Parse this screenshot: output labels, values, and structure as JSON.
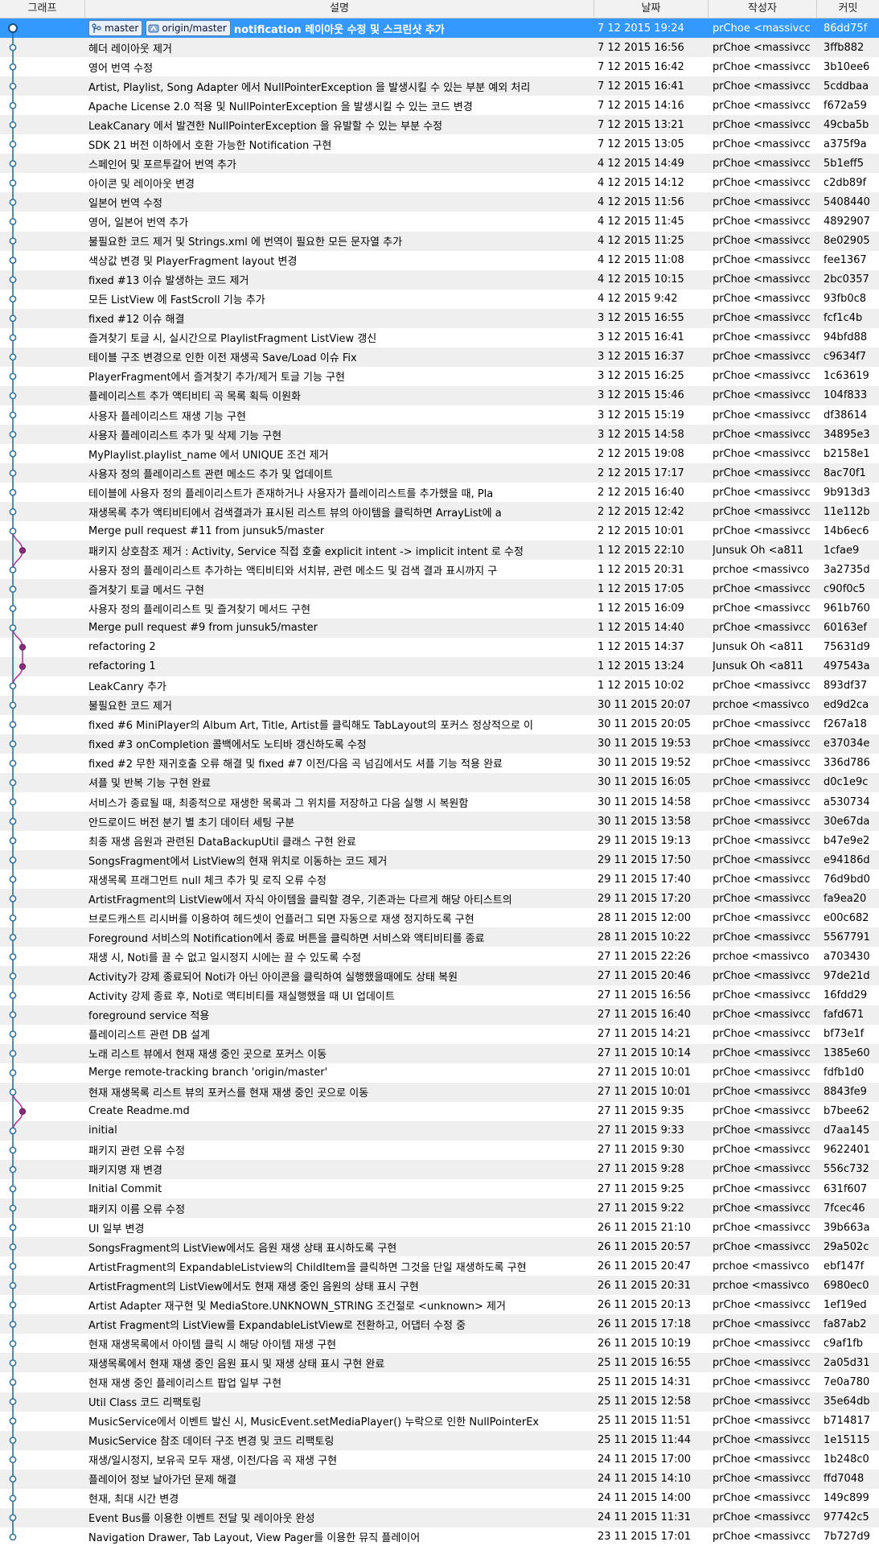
{
  "header": {
    "graph": "그래프",
    "desc": "설명",
    "date": "날짜",
    "author": "작성자",
    "commit": "커밋"
  },
  "tags": [
    {
      "label": "master",
      "icon": "branch-icon"
    },
    {
      "label": "origin/master",
      "icon": "remote-branch-icon"
    }
  ],
  "colors": {
    "selected_row": "#3399ff",
    "main_line": "#2a6f9e",
    "side_line": "#b03aa0",
    "alt_row": "#efefef"
  },
  "commits": [
    {
      "desc": "notification 레이아웃 수정 및 스크린샷 추가",
      "date": "7 12 2015 19:24",
      "author": "prChoe <massivcc",
      "hash": "86dd75f",
      "lane": 0,
      "selected": true,
      "tags": true
    },
    {
      "desc": "헤더 레이아웃 제거",
      "date": "7 12 2015 16:56",
      "author": "prChoe <massivcc",
      "hash": "3ffb882",
      "lane": 0
    },
    {
      "desc": "영어 번역 수정",
      "date": "7 12 2015 16:42",
      "author": "prChoe <massivcc",
      "hash": "3b10ee6",
      "lane": 0
    },
    {
      "desc": "Artist, Playlist, Song Adapter 에서 NullPointerException 을 발생시킬 수 있는 부분 예외 처리",
      "date": "7 12 2015 16:41",
      "author": "prChoe <massivcc",
      "hash": "5cddbaa",
      "lane": 0
    },
    {
      "desc": "Apache License 2.0 적용 및 NullPointerException 을 발생시킬 수 있는 코드 변경",
      "date": "7 12 2015 14:16",
      "author": "prChoe <massivcc",
      "hash": "f672a59",
      "lane": 0
    },
    {
      "desc": "LeakCanary 에서 발견한 NullPointerException 을 유발할 수 있는 부분 수정",
      "date": "7 12 2015 13:21",
      "author": "prChoe <massivcc",
      "hash": "49cba5b",
      "lane": 0
    },
    {
      "desc": "SDK 21 버전 이하에서 호환 가능한 Notification 구현",
      "date": "7 12 2015 13:05",
      "author": "prChoe <massivcc",
      "hash": "a375f9a",
      "lane": 0
    },
    {
      "desc": "스페인어 및 포르투갈어 번역 추가",
      "date": "4 12 2015 14:49",
      "author": "prChoe <massivcc",
      "hash": "5b1eff5",
      "lane": 0
    },
    {
      "desc": "아이콘 및 레이아웃 변경",
      "date": "4 12 2015 14:12",
      "author": "prChoe <massivcc",
      "hash": "c2db89f",
      "lane": 0
    },
    {
      "desc": "일본어 번역 수정",
      "date": "4 12 2015 11:56",
      "author": "prChoe <massivcc",
      "hash": "5408440",
      "lane": 0
    },
    {
      "desc": "영어, 일본어 번역 추가",
      "date": "4 12 2015 11:45",
      "author": "prChoe <massivcc",
      "hash": "4892907",
      "lane": 0
    },
    {
      "desc": "불필요한 코드 제거 및 Strings.xml 에 번역이 필요한 모든 문자열 추가",
      "date": "4 12 2015 11:25",
      "author": "prChoe <massivcc",
      "hash": "8e02905",
      "lane": 0
    },
    {
      "desc": "색상값 변경 및 PlayerFragment layout 변경",
      "date": "4 12 2015 11:08",
      "author": "prChoe <massivcc",
      "hash": "fee1367",
      "lane": 0
    },
    {
      "desc": "fixed #13 이슈 발생하는 코드 제거",
      "date": "4 12 2015 10:15",
      "author": "prChoe <massivcc",
      "hash": "2bc0357",
      "lane": 0
    },
    {
      "desc": "모든 ListView 에 FastScroll 기능 추가",
      "date": "4 12 2015 9:42",
      "author": "prChoe <massivcc",
      "hash": "93fb0c8",
      "lane": 0
    },
    {
      "desc": "fixed #12 이슈 해결",
      "date": "3 12 2015 16:55",
      "author": "prChoe <massivcc",
      "hash": "fcf1c4b",
      "lane": 0
    },
    {
      "desc": "즐겨찾기 토글 시, 실시간으로 PlaylistFragment ListView 갱신",
      "date": "3 12 2015 16:41",
      "author": "prChoe <massivcc",
      "hash": "94bfd88",
      "lane": 0
    },
    {
      "desc": "테이블 구조 변경으로 인한 이전 재생곡 Save/Load 이슈 Fix",
      "date": "3 12 2015 16:37",
      "author": "prChoe <massivcc",
      "hash": "c9634f7",
      "lane": 0
    },
    {
      "desc": "PlayerFragment에서 즐겨찾기 추가/제거 토글 기능 구현",
      "date": "3 12 2015 16:25",
      "author": "prChoe <massivcc",
      "hash": "1c63619",
      "lane": 0
    },
    {
      "desc": "플레이리스트 추가 액티비티 곡 목록 획득 이원화",
      "date": "3 12 2015 15:46",
      "author": "prChoe <massivcc",
      "hash": "104f833",
      "lane": 0
    },
    {
      "desc": "사용자 플레이리스트 재생 기능 구현",
      "date": "3 12 2015 15:19",
      "author": "prChoe <massivcc",
      "hash": "df38614",
      "lane": 0
    },
    {
      "desc": "사용자 플레이리스트 추가 및 삭제 기능 구현",
      "date": "3 12 2015 14:58",
      "author": "prChoe <massivcc",
      "hash": "34895e3",
      "lane": 0
    },
    {
      "desc": "MyPlaylist.playlist_name 에서 UNIQUE 조건 제거",
      "date": "2 12 2015 19:08",
      "author": "prChoe <massivcc",
      "hash": "b2158e1",
      "lane": 0
    },
    {
      "desc": "사용자 정의 플레이리스트 관련 메소드 추가 및 업데이트",
      "date": "2 12 2015 17:17",
      "author": "prChoe <massivcc",
      "hash": "8ac70f1",
      "lane": 0
    },
    {
      "desc": "테이블에 사용자 정의 플레이리스트가 존재하거나 사용자가 플레이리스트를 추가했을 때, Pla",
      "date": "2 12 2015 16:40",
      "author": "prChoe <massivcc",
      "hash": "9b913d3",
      "lane": 0
    },
    {
      "desc": "재생목록 추가 액티비티에서 검색결과가 표시된 리스트 뷰의 아이템을 클릭하면 ArrayList에 a",
      "date": "2 12 2015 12:42",
      "author": "prChoe <massivcc",
      "hash": "11e112b",
      "lane": 0
    },
    {
      "desc": "Merge pull request #11 from junsuk5/master",
      "date": "2 12 2015 10:01",
      "author": "prChoe <massivcc",
      "hash": "14b6ec6",
      "lane": 0
    },
    {
      "desc": "패키지 상호참조 제거 : Activity, Service 직접 호출 explicit intent -> implicit intent 로 수정",
      "date": "1 12 2015 22:10",
      "author": "Junsuk Oh <a811",
      "hash": "1cfae9",
      "lane": 1
    },
    {
      "desc": "사용자 정의 플레이리스트 추가하는 액티비티와 서치뷰, 관련 메소드 및 검색 결과 표시까지 구",
      "date": "1 12 2015 20:31",
      "author": "prchoe <massivco",
      "hash": "3a2735d",
      "lane": 0
    },
    {
      "desc": "즐겨찾기 토글 메서드 구현",
      "date": "1 12 2015 17:05",
      "author": "prChoe <massivcc",
      "hash": "c90f0c5",
      "lane": 0
    },
    {
      "desc": "사용자 정의 플레이리스트 및 즐겨찾기 메서드 구현",
      "date": "1 12 2015 16:09",
      "author": "prChoe <massivcc",
      "hash": "961b760",
      "lane": 0
    },
    {
      "desc": "Merge pull request #9 from junsuk5/master",
      "date": "1 12 2015 14:40",
      "author": "prChoe <massivcc",
      "hash": "60163ef",
      "lane": 0
    },
    {
      "desc": "refactoring 2",
      "date": "1 12 2015 14:37",
      "author": "Junsuk Oh <a811",
      "hash": "75631d9",
      "lane": 1
    },
    {
      "desc": "refactoring 1",
      "date": "1 12 2015 13:24",
      "author": "Junsuk Oh <a811",
      "hash": "497543a",
      "lane": 1
    },
    {
      "desc": "LeakCanry 추가",
      "date": "1 12 2015 10:02",
      "author": "prChoe <massivcc",
      "hash": "893df37",
      "lane": 0
    },
    {
      "desc": "불필요한 코드 제거",
      "date": "30 11 2015 20:07",
      "author": "prchoe <massivco",
      "hash": "ed9d2ca",
      "lane": 0
    },
    {
      "desc": "fixed #6 MiniPlayer의 Album Art, Title, Artist를 클릭해도 TabLayout의 포커스 정상적으로 이",
      "date": "30 11 2015 20:05",
      "author": "prChoe <massivcc",
      "hash": "f267a18",
      "lane": 0
    },
    {
      "desc": "fixed #3 onCompletion 콜백에서도 노티바 갱신하도록 수정",
      "date": "30 11 2015 19:53",
      "author": "prChoe <massivcc",
      "hash": "e37034e",
      "lane": 0
    },
    {
      "desc": "fixed #2 무한 재귀호출 오류 해결 및  fixed #7 이전/다음 곡 넘김에서도 셔플 기능 적용 완료",
      "date": "30 11 2015 19:52",
      "author": "prChoe <massivcc",
      "hash": "336d786",
      "lane": 0
    },
    {
      "desc": "셔플 및 반복 기능 구현 완료",
      "date": "30 11 2015 16:05",
      "author": "prChoe <massivcc",
      "hash": "d0c1e9c",
      "lane": 0
    },
    {
      "desc": "서비스가 종료될 때, 최종적으로 재생한 목록과 그 위치를 저장하고 다음 실행 시 복원함",
      "date": "30 11 2015 14:58",
      "author": "prChoe <massivcc",
      "hash": "a530734",
      "lane": 0
    },
    {
      "desc": "안드로이드 버전 분기 별 초기 데이터 세팅 구분",
      "date": "30 11 2015 13:58",
      "author": "prChoe <massivcc",
      "hash": "30e67da",
      "lane": 0
    },
    {
      "desc": "최종 재생 음원과 관련된 DataBackupUtil 클래스 구현 완료",
      "date": "29 11 2015 19:13",
      "author": "prChoe <massivcc",
      "hash": "b47e9e2",
      "lane": 0
    },
    {
      "desc": "SongsFragment에서 ListView의 현재 위치로 이동하는 코드 제거",
      "date": "29 11 2015 17:50",
      "author": "prChoe <massivcc",
      "hash": "e94186d",
      "lane": 0
    },
    {
      "desc": "재생목록 프래그먼트 null 체크 추가 및 로직 오류 수정",
      "date": "29 11 2015 17:40",
      "author": "prChoe <massivcc",
      "hash": "76d9bd0",
      "lane": 0
    },
    {
      "desc": "ArtistFragment의 ListView에서 자식 아이템을 클릭할 경우, 기존과는 다르게 해당 아티스트의",
      "date": "29 11 2015 17:20",
      "author": "prChoe <massivcc",
      "hash": "fa9ea20",
      "lane": 0
    },
    {
      "desc": "브로드캐스트 리시버를 이용하여 헤드셋이 언플러그 되면 자동으로 재생 정지하도록 구현",
      "date": "28 11 2015 12:00",
      "author": "prChoe <massivcc",
      "hash": "e00c682",
      "lane": 0
    },
    {
      "desc": "Foreground 서비스의 Notification에서 종료 버튼을 클릭하면 서비스와 액티비티를 종료",
      "date": "28 11 2015 10:22",
      "author": "prChoe <massivcc",
      "hash": "5567791",
      "lane": 0
    },
    {
      "desc": "재생 시, Noti를 끌 수 없고 일시정지 시에는 끌 수 있도록 수정",
      "date": "27 11 2015 22:26",
      "author": "prchoe <massivco",
      "hash": "a703430",
      "lane": 0
    },
    {
      "desc": "Activity가 강제 종료되어 Noti가 아닌 아이콘을 클릭하여 실행했을때에도 상태 복원",
      "date": "27 11 2015 20:46",
      "author": "prChoe <massivcc",
      "hash": "97de21d",
      "lane": 0
    },
    {
      "desc": "Activity 강제 종료 후, Noti로 액티비티를 재실행했을 때 UI 업데이트",
      "date": "27 11 2015 16:56",
      "author": "prChoe <massivcc",
      "hash": "16fdd29",
      "lane": 0
    },
    {
      "desc": "foreground service 적용",
      "date": "27 11 2015 16:40",
      "author": "prChoe <massivcc",
      "hash": "fafd671",
      "lane": 0
    },
    {
      "desc": "플레이리스트 관련 DB 설계",
      "date": "27 11 2015 14:21",
      "author": "prChoe <massivcc",
      "hash": "bf73e1f",
      "lane": 0
    },
    {
      "desc": "노래 리스트 뷰에서 현재 재생 중인 곳으로 포커스 이동",
      "date": "27 11 2015 10:14",
      "author": "prChoe <massivcc",
      "hash": "1385e60",
      "lane": 0
    },
    {
      "desc": "Merge remote-tracking branch 'origin/master'",
      "date": "27 11 2015 10:01",
      "author": "prChoe <massivcc",
      "hash": "fdfb1d0",
      "lane": 0
    },
    {
      "desc": "현재 재생목록 리스트 뷰의 포커스를 현재 재생 중인 곳으로 이동",
      "date": "27 11 2015 10:01",
      "author": "prChoe <massivcc",
      "hash": "8843fe9",
      "lane": 0
    },
    {
      "desc": "Create Readme.md",
      "date": "27 11 2015 9:35",
      "author": "prChoe <massivcc",
      "hash": "b7bee62",
      "lane": 1
    },
    {
      "desc": "initial",
      "date": "27 11 2015 9:33",
      "author": "prChoe <massivcc",
      "hash": "d7aa145",
      "lane": 0
    },
    {
      "desc": "패키지 관련 오류 수정",
      "date": "27 11 2015 9:30",
      "author": "prChoe <massivcc",
      "hash": "9622401",
      "lane": 0
    },
    {
      "desc": "패키지명 재 변경",
      "date": "27 11 2015 9:28",
      "author": "prChoe <massivcc",
      "hash": "556c732",
      "lane": 0
    },
    {
      "desc": "Initial Commit",
      "date": "27 11 2015 9:25",
      "author": "prChoe <massivcc",
      "hash": "631f607",
      "lane": 0
    },
    {
      "desc": "패키지 이름 오류 수정",
      "date": "27 11 2015 9:22",
      "author": "prChoe <massivcc",
      "hash": "7fcec46",
      "lane": 0
    },
    {
      "desc": "UI 일부 변경",
      "date": "26 11 2015 21:10",
      "author": "prChoe <massivcc",
      "hash": "39b663a",
      "lane": 0
    },
    {
      "desc": "SongsFragment의 ListView에서도 음원 재생 상태 표시하도록 구현",
      "date": "26 11 2015 20:57",
      "author": "prChoe <massivcc",
      "hash": "29a502c",
      "lane": 0
    },
    {
      "desc": "ArtistFragment의 ExpandableListview의 ChildItem을 클릭하면 그것을 단일 재생하도록 구현",
      "date": "26 11 2015 20:47",
      "author": "prchoe <massivco",
      "hash": "ebf147f",
      "lane": 0
    },
    {
      "desc": "ArtistFragment의 ListView에서도 현재 재생 중인 음원의 상태 표시 구현",
      "date": "26 11 2015 20:31",
      "author": "prchoe <massivco",
      "hash": "6980ec0",
      "lane": 0
    },
    {
      "desc": "Artist Adapter 재구현 및 MediaStore.UNKNOWN_STRING 조건절로 <unknown> 제거",
      "date": "26 11 2015 20:13",
      "author": "prChoe <massivcc",
      "hash": "1ef19ed",
      "lane": 0
    },
    {
      "desc": "Artist Fragment의 ListView를 ExpandableListView로 전환하고, 어댑터 수정 중",
      "date": "26 11 2015 17:18",
      "author": "prChoe <massivcc",
      "hash": "fa87ab2",
      "lane": 0
    },
    {
      "desc": "현재 재생목록에서 아이템 클릭 시 해당 아이템 재생 구현",
      "date": "26 11 2015 10:19",
      "author": "prChoe <massivcc",
      "hash": "c9af1fb",
      "lane": 0
    },
    {
      "desc": "재생목록에서 현재 재생 중인 음원 표시 및 재생 상태 표시 구현 완료",
      "date": "25 11 2015 16:55",
      "author": "prChoe <massivcc",
      "hash": "2a05d31",
      "lane": 0
    },
    {
      "desc": "현재 재생 중인 플레이리스트 팝업 일부 구현",
      "date": "25 11 2015 14:31",
      "author": "prChoe <massivcc",
      "hash": "7e0a780",
      "lane": 0
    },
    {
      "desc": "Util Class 코드 리팩토링",
      "date": "25 11 2015 12:58",
      "author": "prChoe <massivcc",
      "hash": "35e64db",
      "lane": 0
    },
    {
      "desc": "MusicService에서 이벤트 발신 시, MusicEvent.setMediaPlayer() 누락으로 인한 NullPointerEx",
      "date": "25 11 2015 11:51",
      "author": "prChoe <massivcc",
      "hash": "b714817",
      "lane": 0
    },
    {
      "desc": "MusicService 참조 데이터 구조 변경 및 코드 리팩토링",
      "date": "25 11 2015 11:44",
      "author": "prChoe <massivcc",
      "hash": "1e15115",
      "lane": 0
    },
    {
      "desc": "재생/일시정지, 보유곡 모두 재생, 이전/다음 곡 재생 구현",
      "date": "24 11 2015 17:00",
      "author": "prChoe <massivcc",
      "hash": "1b248c0",
      "lane": 0
    },
    {
      "desc": "플레이어 정보 날아가던 문제 해결",
      "date": "24 11 2015 14:10",
      "author": "prChoe <massivcc",
      "hash": "ffd7048",
      "lane": 0
    },
    {
      "desc": "현재, 최대 시간 변경",
      "date": "24 11 2015 14:00",
      "author": "prChoe <massivcc",
      "hash": "149c899",
      "lane": 0
    },
    {
      "desc": "Event Bus를 이용한 이벤트 전달 및 레이아웃 완성",
      "date": "24 11 2015 11:31",
      "author": "prChoe <massivcc",
      "hash": "97742c5",
      "lane": 0
    },
    {
      "desc": "Navigation Drawer, Tab Layout, View Pager를 이용한 뮤직 플레이어",
      "date": "23 11 2015 17:01",
      "author": "prChoe <massivcc",
      "hash": "7b727d9",
      "lane": 0
    }
  ]
}
